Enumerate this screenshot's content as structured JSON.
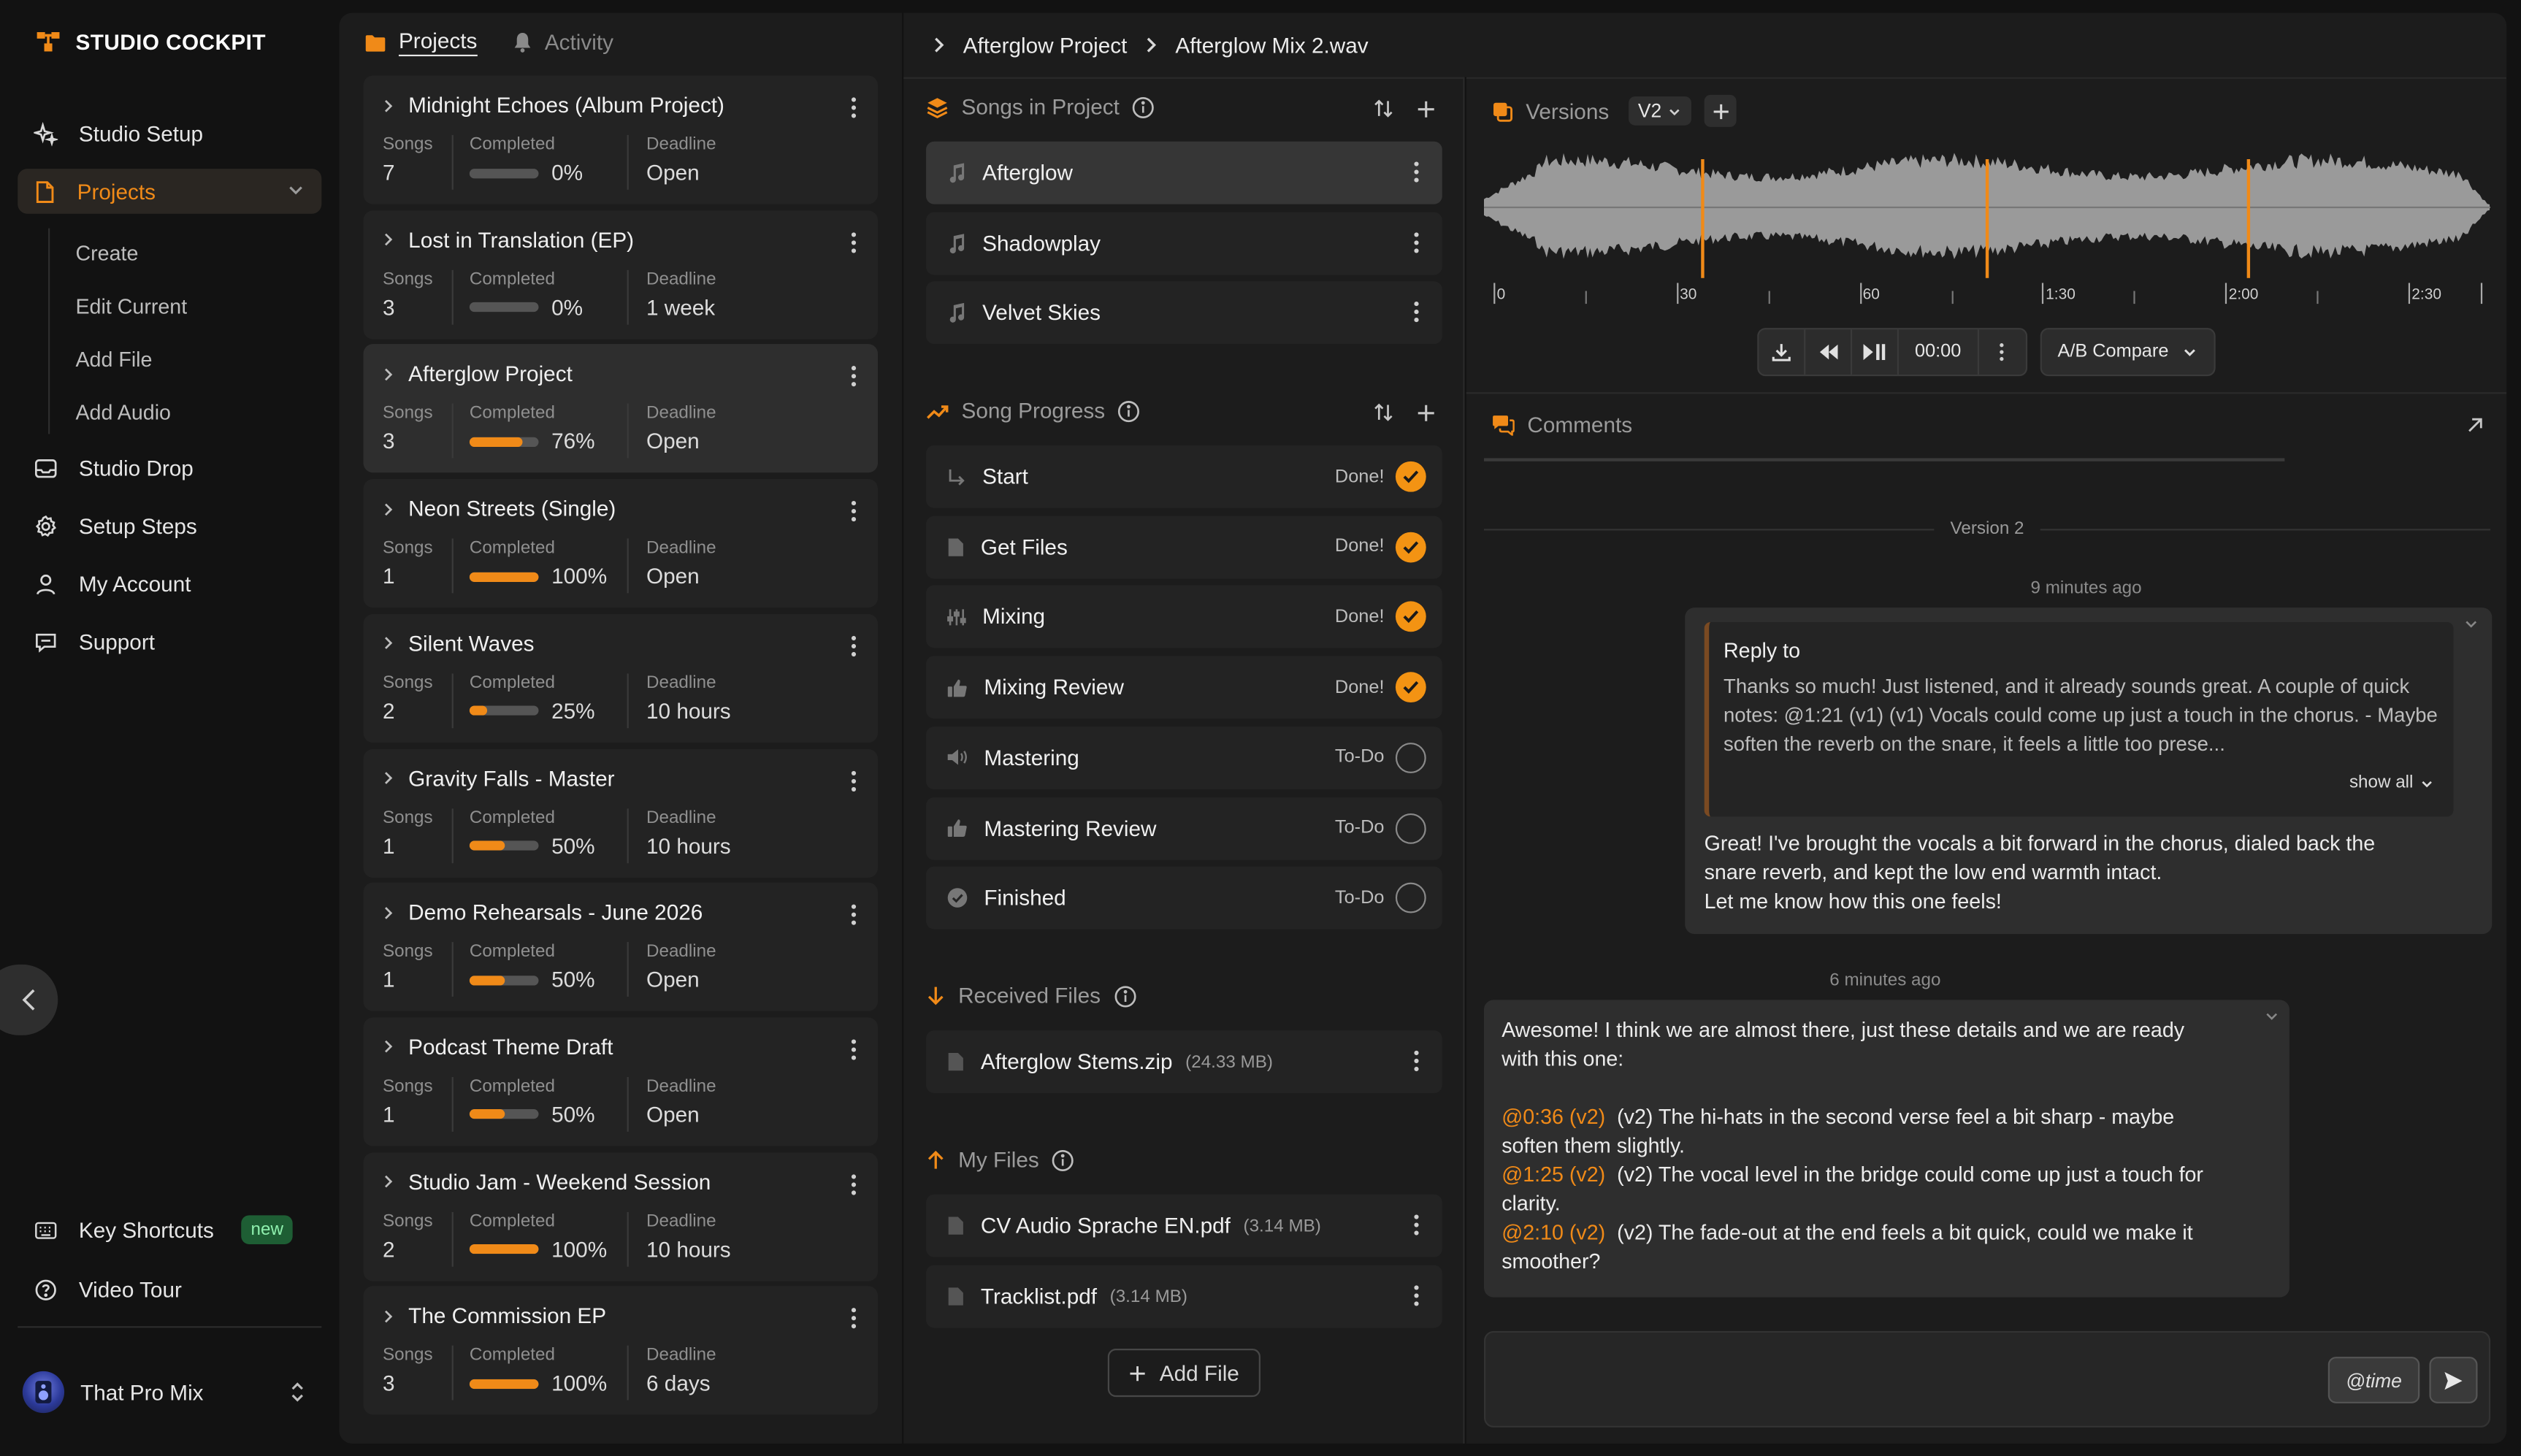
{
  "brand": {
    "name": "STUDIO COCKPIT"
  },
  "sidebar": {
    "items": [
      {
        "label": "Studio Setup",
        "icon": "sparkle-icon"
      },
      {
        "label": "Projects",
        "icon": "file-icon",
        "active": true
      },
      {
        "label": "Studio Drop",
        "icon": "inbox-icon"
      },
      {
        "label": "Setup Steps",
        "icon": "gear-icon"
      },
      {
        "label": "My Account",
        "icon": "user-icon"
      },
      {
        "label": "Support",
        "icon": "chat-icon"
      }
    ],
    "subitems": [
      "Create",
      "Edit Current",
      "Add File",
      "Add Audio"
    ],
    "bottom": [
      {
        "label": "Key Shortcuts",
        "badge": "new",
        "icon": "keyboard-icon"
      },
      {
        "label": "Video Tour",
        "icon": "help-icon"
      }
    ],
    "user": {
      "name": "That Pro Mix"
    }
  },
  "projects_panel": {
    "tabs": [
      {
        "label": "Projects",
        "active": true
      },
      {
        "label": "Activity"
      }
    ],
    "labels": {
      "songs": "Songs",
      "completed": "Completed",
      "deadline": "Deadline"
    },
    "projects": [
      {
        "title": "Midnight Echoes (Album Project)",
        "songs": "7",
        "completed": "0%",
        "progress": 0,
        "deadline": "Open"
      },
      {
        "title": "Lost in Translation (EP)",
        "songs": "3",
        "completed": "0%",
        "progress": 0,
        "deadline": "1 week"
      },
      {
        "title": "Afterglow Project",
        "songs": "3",
        "completed": "76%",
        "progress": 76,
        "deadline": "Open",
        "selected": true
      },
      {
        "title": "Neon Streets (Single)",
        "songs": "1",
        "completed": "100%",
        "progress": 100,
        "deadline": "Open"
      },
      {
        "title": "Silent Waves",
        "songs": "2",
        "completed": "25%",
        "progress": 25,
        "deadline": "10 hours"
      },
      {
        "title": "Gravity Falls - Master",
        "songs": "1",
        "completed": "50%",
        "progress": 50,
        "deadline": "10 hours"
      },
      {
        "title": "Demo Rehearsals - June 2026",
        "songs": "1",
        "completed": "50%",
        "progress": 50,
        "deadline": "Open"
      },
      {
        "title": "Podcast Theme Draft",
        "songs": "1",
        "completed": "50%",
        "progress": 50,
        "deadline": "Open"
      },
      {
        "title": "Studio Jam - Weekend Session",
        "songs": "2",
        "completed": "100%",
        "progress": 100,
        "deadline": "10 hours"
      },
      {
        "title": "The Commission EP",
        "songs": "3",
        "completed": "100%",
        "progress": 100,
        "deadline": "6 days"
      }
    ]
  },
  "breadcrumb": {
    "project": "Afterglow Project",
    "file": "Afterglow Mix 2.wav"
  },
  "songs_section": {
    "title": "Songs in Project",
    "songs": [
      {
        "name": "Afterglow",
        "selected": true
      },
      {
        "name": "Shadowplay"
      },
      {
        "name": "Velvet Skies"
      }
    ]
  },
  "progress_section": {
    "title": "Song Progress",
    "steps": [
      {
        "name": "Start",
        "status": "Done!",
        "done": true,
        "icon": "arrow-corner-icon"
      },
      {
        "name": "Get Files",
        "status": "Done!",
        "done": true,
        "icon": "file-icon"
      },
      {
        "name": "Mixing",
        "status": "Done!",
        "done": true,
        "icon": "sliders-icon"
      },
      {
        "name": "Mixing Review",
        "status": "Done!",
        "done": true,
        "icon": "thumbs-up-icon"
      },
      {
        "name": "Mastering",
        "status": "To-Do",
        "done": false,
        "icon": "speaker-icon"
      },
      {
        "name": "Mastering Review",
        "status": "To-Do",
        "done": false,
        "icon": "thumbs-up-icon"
      },
      {
        "name": "Finished",
        "status": "To-Do",
        "done": false,
        "icon": "check-circle-icon"
      }
    ]
  },
  "received_files": {
    "title": "Received Files",
    "files": [
      {
        "name": "Afterglow Stems.zip",
        "size": "(24.33 MB)"
      }
    ]
  },
  "my_files": {
    "title": "My Files",
    "files": [
      {
        "name": "CV Audio Sprache EN.pdf",
        "size": "(3.14 MB)"
      },
      {
        "name": "Tracklist.pdf",
        "size": "(3.14 MB)"
      }
    ],
    "add_label": "Add File"
  },
  "versions": {
    "title": "Versions",
    "selected": "V2",
    "ticks": [
      "0",
      "30",
      "60",
      "1:30",
      "2:00",
      "2:30"
    ],
    "time": "00:00",
    "ab_label": "A/B Compare",
    "markers_seconds": [
      36,
      85,
      130
    ]
  },
  "comments": {
    "title": "Comments",
    "version_label": "Version 2",
    "time1": "9 minutes ago",
    "reply": {
      "title": "Reply to",
      "body": "Thanks so much! Just listened, and it already sounds great. A couple of quick notes: @1:21 (v1) (v1) Vocals could come up just a touch in the chorus. - Maybe soften the reverb on the snare, it feels a little too prese...",
      "show_all": "show all"
    },
    "msg1": [
      "Great! I've brought the vocals a bit forward in the chorus, dialed back the",
      "snare reverb, and kept the low end warmth intact.",
      "Let me know how this one feels!"
    ],
    "time2": "6 minutes ago",
    "msg2_intro": [
      "Awesome! I think we are almost there, just these details and we are ready",
      "with this one:"
    ],
    "msg2_items": [
      {
        "tag": "@0:36 (v2)",
        "text": "(v2) The hi-hats in the second verse feel a bit sharp - maybe",
        "cont": "soften them slightly."
      },
      {
        "tag": "@1:25 (v2)",
        "text": "(v2) The vocal level in the bridge could come up just a touch for",
        "cont": "clarity."
      },
      {
        "tag": "@2:10 (v2)",
        "text": "(v2) The fade-out at the end feels a bit quick, could we make it",
        "cont": "smoother?"
      }
    ],
    "composer_time_btn": "@time"
  },
  "colors": {
    "accent": "#f08a18",
    "done": "#f39313",
    "badge_bg": "#1e5e34",
    "badge_fg": "#8ff0ae"
  }
}
